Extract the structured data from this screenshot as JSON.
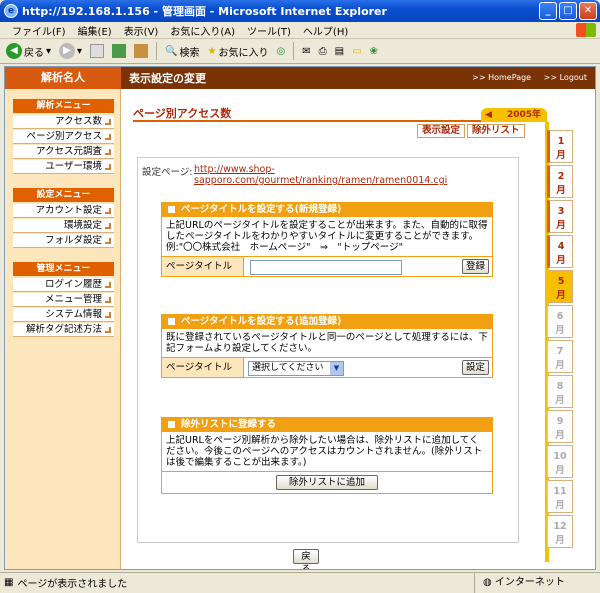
{
  "window": {
    "title": "http://192.168.1.156 - 管理画面 - Microsoft Internet Explorer"
  },
  "menubar": [
    "ファイル(F)",
    "編集(E)",
    "表示(V)",
    "お気に入り(A)",
    "ツール(T)",
    "ヘルプ(H)"
  ],
  "toolbar": {
    "back": "戻る",
    "search": "検索",
    "favorites": "お気に入り"
  },
  "header": {
    "brand": "解析名人",
    "page_title": "表示設定の変更",
    "home": ">> HomePage",
    "logout": ">> Logout"
  },
  "sidebar": {
    "sections": [
      {
        "title": "解析メニュー",
        "items": [
          "アクセス数",
          "ページ別アクセス",
          "アクセス元調査",
          "ユーザー環境"
        ]
      },
      {
        "title": "設定メニュー",
        "items": [
          "アカウント設定",
          "環境設定",
          "フォルダ設定"
        ]
      },
      {
        "title": "管理メニュー",
        "items": [
          "ログイン履歴",
          "メニュー管理",
          "システム情報",
          "解析タグ記述方法"
        ]
      }
    ]
  },
  "main": {
    "section_title": "ページ別アクセス数",
    "year": "2005年",
    "subtabs": [
      "表示設定",
      "除外リスト"
    ],
    "months": [
      "1\n月",
      "2\n月",
      "3\n月",
      "4\n月",
      "5\n月",
      "6\n月",
      "7\n月",
      "8\n月",
      "9\n月",
      "10\n月",
      "11\n月",
      "12\n月"
    ],
    "active_month_index": 4,
    "setting_page_label": "設定ページ:",
    "setting_page_url": "http://www.shop-sapporo.com/gourmet/ranking/ramen/ramen0014.cgi",
    "box1": {
      "title": "ページタイトルを設定する(新規登録)",
      "text": "上記URLのページタイトルを設定することが出来ます。また、自動的に取得したページタイトルをわかりやすいタイトルに変更することができます。例:\"〇〇株式会社　ホームページ\"　⇒　\"トップページ\"",
      "field_label": "ページタイトル",
      "field_value": "",
      "button": "登録"
    },
    "box2": {
      "title": "ページタイトルを設定する(追加登録)",
      "text": "既に登録されているページタイトルと同一のページとして処理するには、下記フォームより設定してください。",
      "field_label": "ページタイトル",
      "select_value": "選択してください",
      "button": "設定"
    },
    "box3": {
      "title": "除外リストに登録する",
      "text": "上記URLをページ別解析から除外したい場合は、除外リストに追加してください。今後このページへのアクセスはカウントされません。(除外リストは後で編集することが出来ます。)",
      "button": "除外リストに追加"
    },
    "back_button": "戻る"
  },
  "status": {
    "text": "ページが表示されました",
    "zone": "インターネット"
  }
}
